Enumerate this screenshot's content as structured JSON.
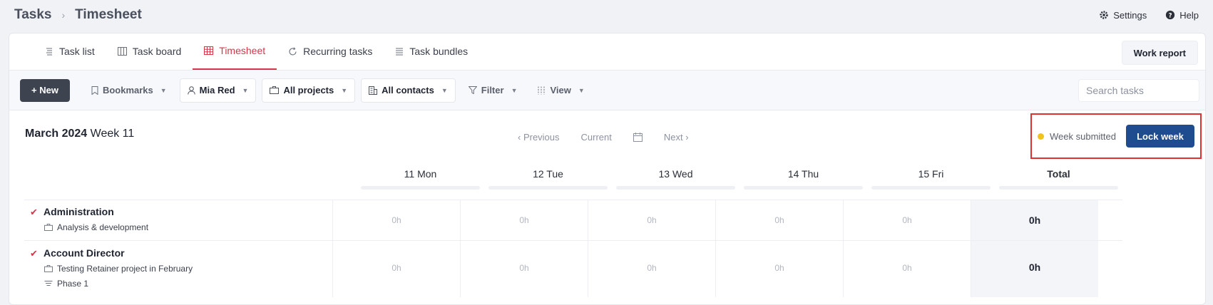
{
  "breadcrumb": {
    "root": "Tasks",
    "separator": "›",
    "page": "Timesheet"
  },
  "top_actions": {
    "settings": "Settings",
    "help": "Help"
  },
  "tabs": [
    {
      "label": "Task list",
      "icon": "list-icon"
    },
    {
      "label": "Task board",
      "icon": "board-icon"
    },
    {
      "label": "Timesheet",
      "icon": "grid-icon",
      "active": true
    },
    {
      "label": "Recurring tasks",
      "icon": "refresh-icon"
    },
    {
      "label": "Task bundles",
      "icon": "bundle-icon"
    }
  ],
  "work_report": "Work report",
  "toolbar": {
    "new_label": "+ New",
    "bookmarks": "Bookmarks",
    "user": "Mia Red",
    "projects": "All projects",
    "contacts": "All contacts",
    "filter": "Filter",
    "view": "View",
    "search_placeholder": "Search tasks"
  },
  "week": {
    "month_year": "March 2024",
    "week_label": "Week 11",
    "previous": "‹ Previous",
    "current": "Current",
    "next": "Next ›",
    "status": "Week submitted",
    "lock": "Lock week"
  },
  "columns": [
    "11 Mon",
    "12 Tue",
    "13 Wed",
    "14 Thu",
    "15 Fri"
  ],
  "total_header": "Total",
  "rows": [
    {
      "task": "Administration",
      "subs": [
        {
          "icon": "briefcase-icon",
          "text": "Analysis & development"
        }
      ],
      "hours": [
        "0h",
        "0h",
        "0h",
        "0h",
        "0h"
      ],
      "total": "0h"
    },
    {
      "task": "Account Director",
      "subs": [
        {
          "icon": "briefcase-icon",
          "text": "Testing Retainer project in February"
        },
        {
          "icon": "phase-icon",
          "text": "Phase 1"
        }
      ],
      "hours": [
        "0h",
        "0h",
        "0h",
        "0h",
        "0h"
      ],
      "total": "0h"
    }
  ],
  "colors": {
    "accent": "#d4364a",
    "primary": "#1f4c8e",
    "status_dot": "#f2c21f",
    "highlight": "#e0302f"
  }
}
